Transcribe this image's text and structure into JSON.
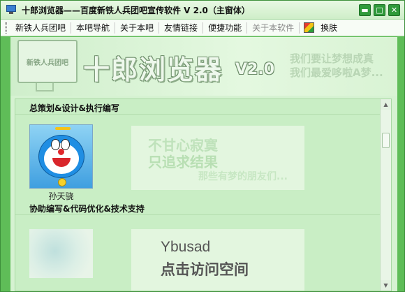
{
  "window": {
    "title": "十郎浏览器——百度新铁人兵团吧宣传软件 V 2.0（主窗体）",
    "controls": {
      "minimize": "▬",
      "maximize": "□",
      "close": "✕"
    }
  },
  "menu": {
    "items": [
      {
        "label": "新铁人兵团吧",
        "enabled": true
      },
      {
        "label": "本吧导航",
        "enabled": true
      },
      {
        "label": "关于本吧",
        "enabled": true
      },
      {
        "label": "友情链接",
        "enabled": true
      },
      {
        "label": "便捷功能",
        "enabled": true
      },
      {
        "label": "关于本软件",
        "enabled": false
      }
    ],
    "skin": {
      "label": "换肤",
      "icon": "palette-icon"
    }
  },
  "banner": {
    "monitor_text": "新铁人兵团吧",
    "title": "十郎浏览器",
    "version": "V2.0",
    "slogan_line1": "我们要让梦想成真",
    "slogan_line2": "我们最爱哆啦A梦..."
  },
  "sections": [
    {
      "title": "总策划&设计&执行编写",
      "person_name": "孙天骁",
      "avatar": "doraemon-avatar",
      "card_line1": "不甘心寂寞",
      "card_line2": "只追求结果",
      "card_line3": "那些有梦的朋友们..."
    },
    {
      "title": "协助编写&代码优化&技术支持",
      "avatar": "watercolor-avatar",
      "card_name": "Ybusad",
      "card_link": "点击访问空间"
    }
  ],
  "colors": {
    "window_green": "#5fbd58",
    "content_bg": "#d6f2d2",
    "menu_bg": "#f7fcf6"
  }
}
